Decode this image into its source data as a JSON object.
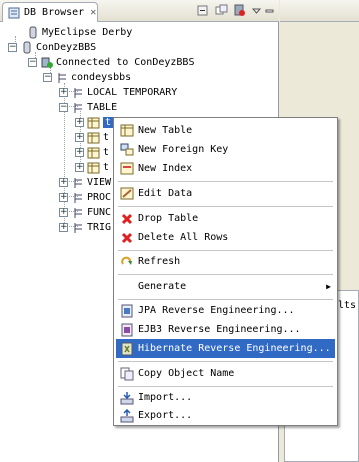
{
  "view": {
    "tab_title": "DB Browser",
    "tab_close": "✕"
  },
  "tree": {
    "myeclipse_derby": "MyEclipse Derby",
    "condeyzbbs": "ConDeyzBBS",
    "connected": "Connected to ConDeyzBBS",
    "schema": "condeysbbs",
    "local_temporary": "LOCAL TEMPORARY",
    "table": "TABLE",
    "selected_table": "t",
    "table_2": "t",
    "table_3": "t",
    "table_4": "t",
    "view": "VIEW",
    "procedure": "PROC",
    "function": "FUNC",
    "trigger": "TRIG"
  },
  "right_panel": {
    "partial_text": "lts"
  },
  "menu": {
    "new_table": "New Table",
    "new_foreign_key": "New Foreign Key",
    "new_index": "New Index",
    "edit_data": "Edit Data",
    "drop_table": "Drop Table",
    "delete_all_rows": "Delete All Rows",
    "refresh": "Refresh",
    "generate": "Generate",
    "jpa": "JPA Reverse Engineering...",
    "ejb3": "EJB3 Reverse Engineering...",
    "hibernate": "Hibernate Reverse Engineering...",
    "copy_object_name": "Copy Object Name",
    "import": "Import...",
    "export": "Export..."
  },
  "toggles": {
    "collapsed": "+",
    "expanded": "−"
  },
  "colors": {
    "selection": "#316ac5",
    "drop_icon": "#d22",
    "menu_border": "#808080"
  }
}
